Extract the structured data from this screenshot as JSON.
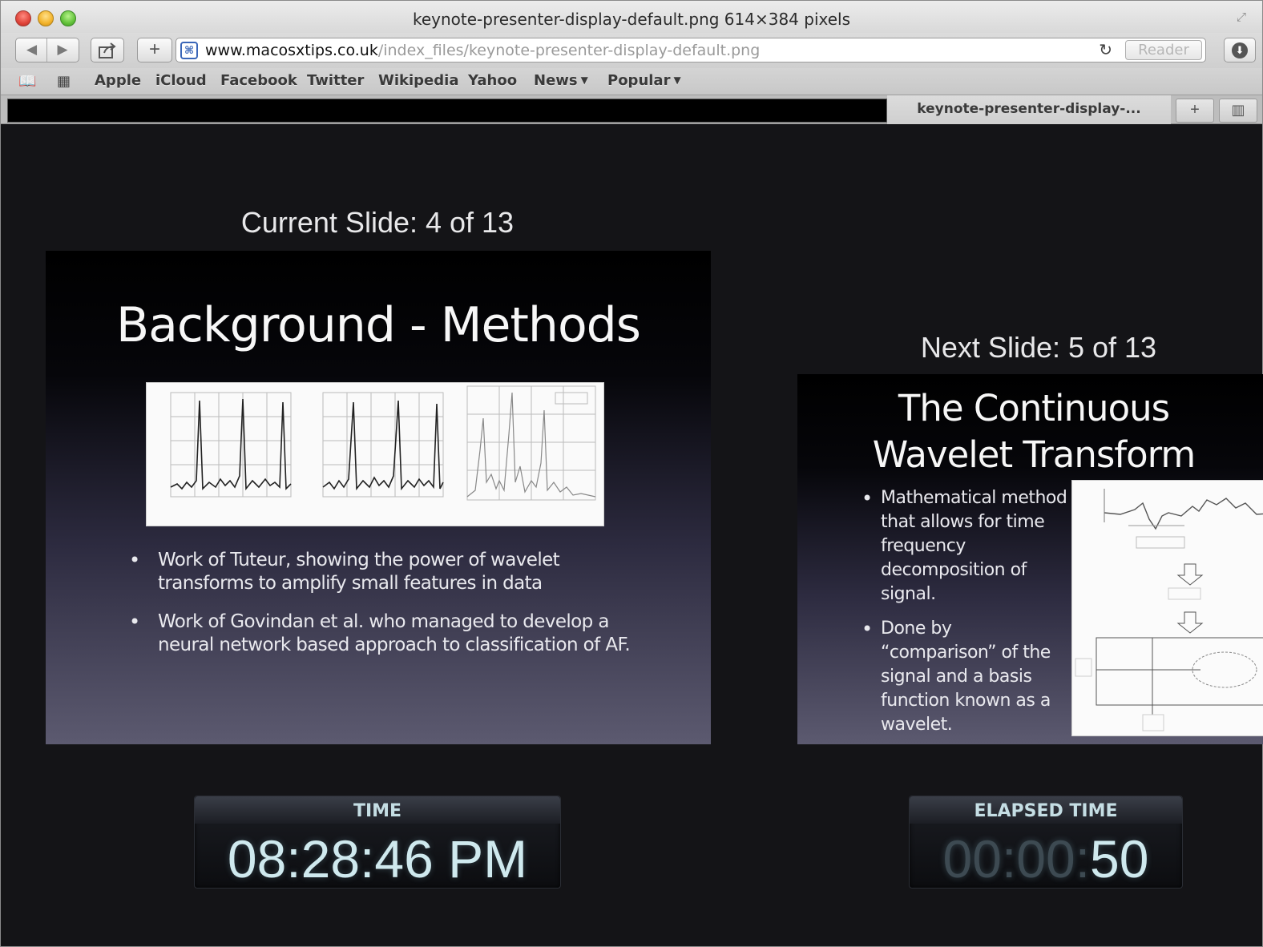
{
  "window": {
    "title": "keynote-presenter-display-default.png 614×384 pixels"
  },
  "toolbar": {
    "back_icon": "◀",
    "forward_icon": "▶",
    "share_icon": "share-icon",
    "add_icon": "+",
    "url_domain": "www.macosxtips.co.uk",
    "url_path": "/index_files/keynote-presenter-display-default.png",
    "reload_icon": "↻",
    "reader_label": "Reader",
    "download_icon": "download-icon"
  },
  "bookmarks": {
    "items": [
      {
        "label": "Apple",
        "dropdown": false
      },
      {
        "label": "iCloud",
        "dropdown": false
      },
      {
        "label": "Facebook",
        "dropdown": false
      },
      {
        "label": "Twitter",
        "dropdown": false
      },
      {
        "label": "Wikipedia",
        "dropdown": false
      },
      {
        "label": "Yahoo",
        "dropdown": false
      },
      {
        "label": "News",
        "dropdown": true
      },
      {
        "label": "Popular",
        "dropdown": true
      }
    ]
  },
  "tabs": {
    "active_label": "keynote-presenter-display-..."
  },
  "presenter": {
    "current_label": "Current Slide: 4 of 13",
    "next_label": "Next Slide: 5 of 13",
    "current_slide": {
      "title": "Background - Methods",
      "bullets": [
        "Work of Tuteur, showing the power of wavelet transforms to amplify small features in data",
        "Work of Govindan et al. who managed to develop a neural network based approach to classification of AF."
      ]
    },
    "next_slide": {
      "title_line1": "The Continuous",
      "title_line2": "Wavelet Transform",
      "bullets": [
        "Mathematical method that allows for time frequency decomposition of signal.",
        "Done by “comparison” of the signal and a basis function known as a wavelet."
      ]
    },
    "time": {
      "label": "TIME",
      "value": "08:28:46 PM"
    },
    "elapsed": {
      "label": "ELAPSED TIME",
      "dim_part": "00:00:",
      "bright_part": "50"
    }
  },
  "colors": {
    "background": "#141417",
    "clock_text": "#cfe9ee",
    "clock_dim": "#3d4a52"
  }
}
